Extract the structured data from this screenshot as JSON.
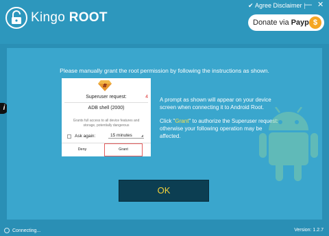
{
  "header": {
    "logo_primary": "Kingo",
    "logo_secondary": "ROOT",
    "agree_disclaimer": "Agree Disclaimer",
    "separator": "|",
    "minimize": "—",
    "close": "✕"
  },
  "donate": {
    "label": "Donate via",
    "brand": "Paypal",
    "coin": "$"
  },
  "instruction": "Please manually grant the root permission by following the instructions as shown.",
  "superuser_dialog": {
    "title": "Superuser request:",
    "count": "4",
    "app": "ADB shell (2000)",
    "grants_text": "Grants full access to all device features and storage, potentially dangerous",
    "ask_again": "Ask again:",
    "minutes": "15 minutes",
    "deny": "Deny",
    "grant": "Grant"
  },
  "description": {
    "paragraph1": "A prompt as shown will appear on your device screen when connecting it to Android Root.",
    "p2_before": "Click \"",
    "p2_grant": "Grant",
    "p2_after": "\" to authorize the Superuser request: otherwise your following operation may be affected."
  },
  "ok_button": "OK",
  "side_info": "i",
  "status": "Connecting...",
  "version": "Version: 1.2.7",
  "colors": {
    "background": "#2a8fb5",
    "panel": "#3aa6cd",
    "ok_button": "#0c3e52",
    "ok_text": "#f3d23a",
    "grant_highlight": "#f9e04b"
  },
  "icons": [
    "unlock-icon",
    "checkbox-icon",
    "superuser-icon",
    "coin-icon",
    "android-icon",
    "info-icon",
    "spinner-icon"
  ]
}
